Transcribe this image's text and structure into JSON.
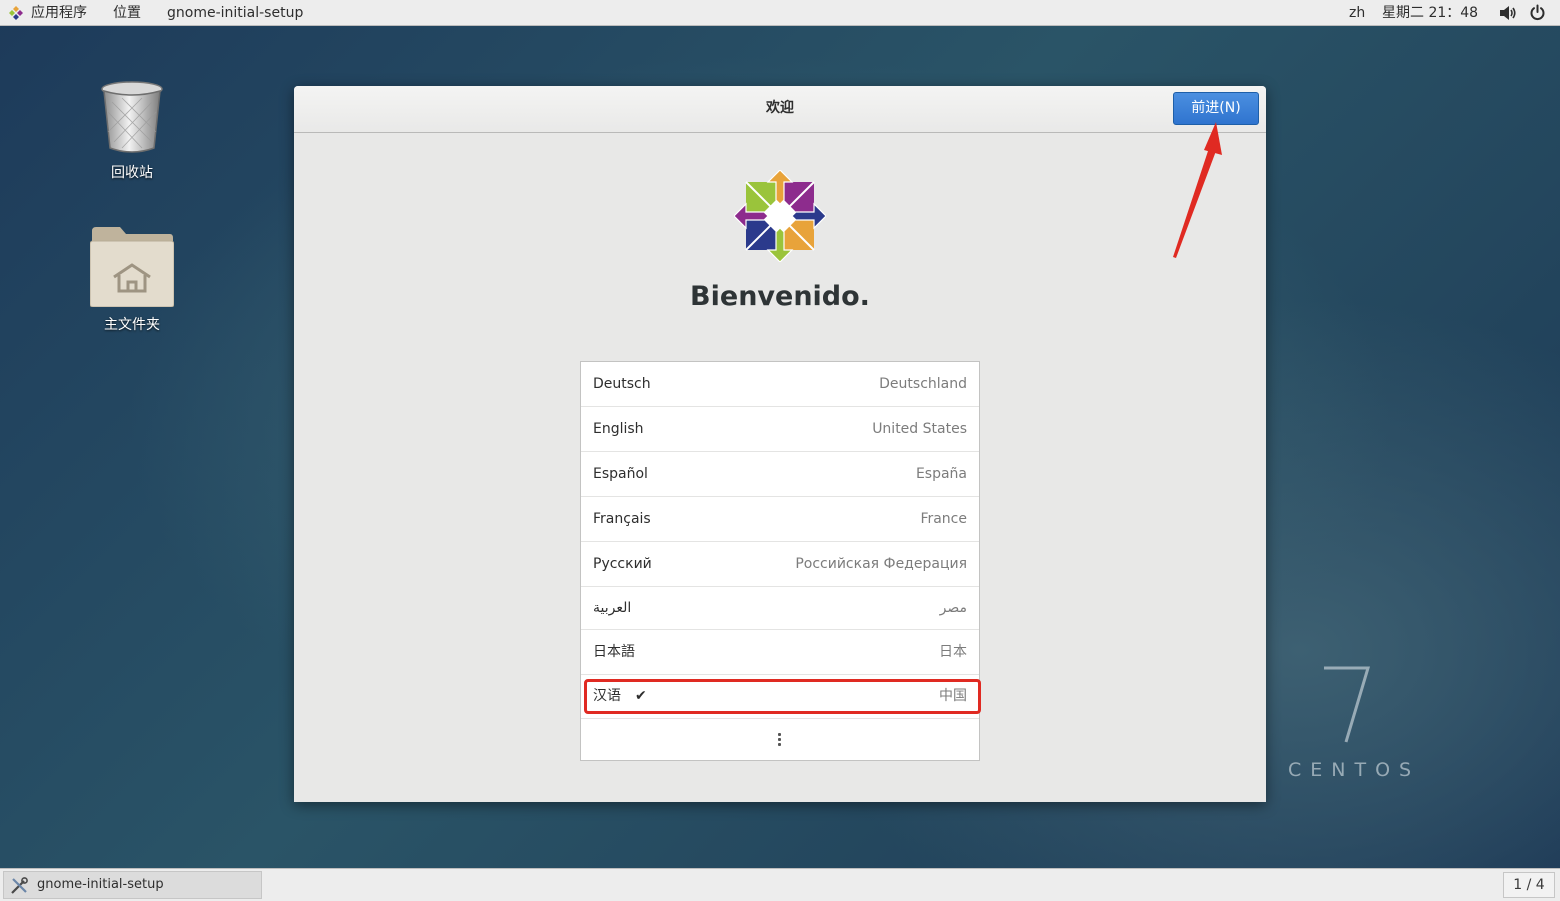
{
  "topbar": {
    "apps_menu": "应用程序",
    "places_menu": "位置",
    "active_app": "gnome-initial-setup",
    "input_method": "zh",
    "clock": "星期二 21：48",
    "volume_icon": "speaker-icon",
    "power_icon": "power-icon"
  },
  "desktop": {
    "icons": [
      {
        "label": "回收站",
        "icon": "trash-icon"
      },
      {
        "label": "主文件夹",
        "icon": "home-folder-icon"
      }
    ]
  },
  "dialog": {
    "title": "欢迎",
    "next_button": "前进(N)",
    "welcome_text": "Bienvenido.",
    "languages": [
      {
        "name": "Deutsch",
        "region": "Deutschland",
        "selected": false
      },
      {
        "name": "English",
        "region": "United States",
        "selected": false
      },
      {
        "name": "Español",
        "region": "España",
        "selected": false
      },
      {
        "name": "Français",
        "region": "France",
        "selected": false
      },
      {
        "name": "Русский",
        "region": "Российская Федерация",
        "selected": false
      },
      {
        "name": "العربية",
        "region": "مصر",
        "selected": false
      },
      {
        "name": "日本語",
        "region": "日本",
        "selected": false
      },
      {
        "name": "汉语",
        "region": "中国",
        "selected": true
      }
    ],
    "checkmark": "✔",
    "more_icon": "vertical-dots-icon"
  },
  "watermark": {
    "version": "7",
    "brand": "CENTOS"
  },
  "taskbar": {
    "window_title": "gnome-initial-setup",
    "workspace": "1 / 4"
  },
  "colors": {
    "accent": "#3079d6",
    "highlight": "#e02a22"
  }
}
